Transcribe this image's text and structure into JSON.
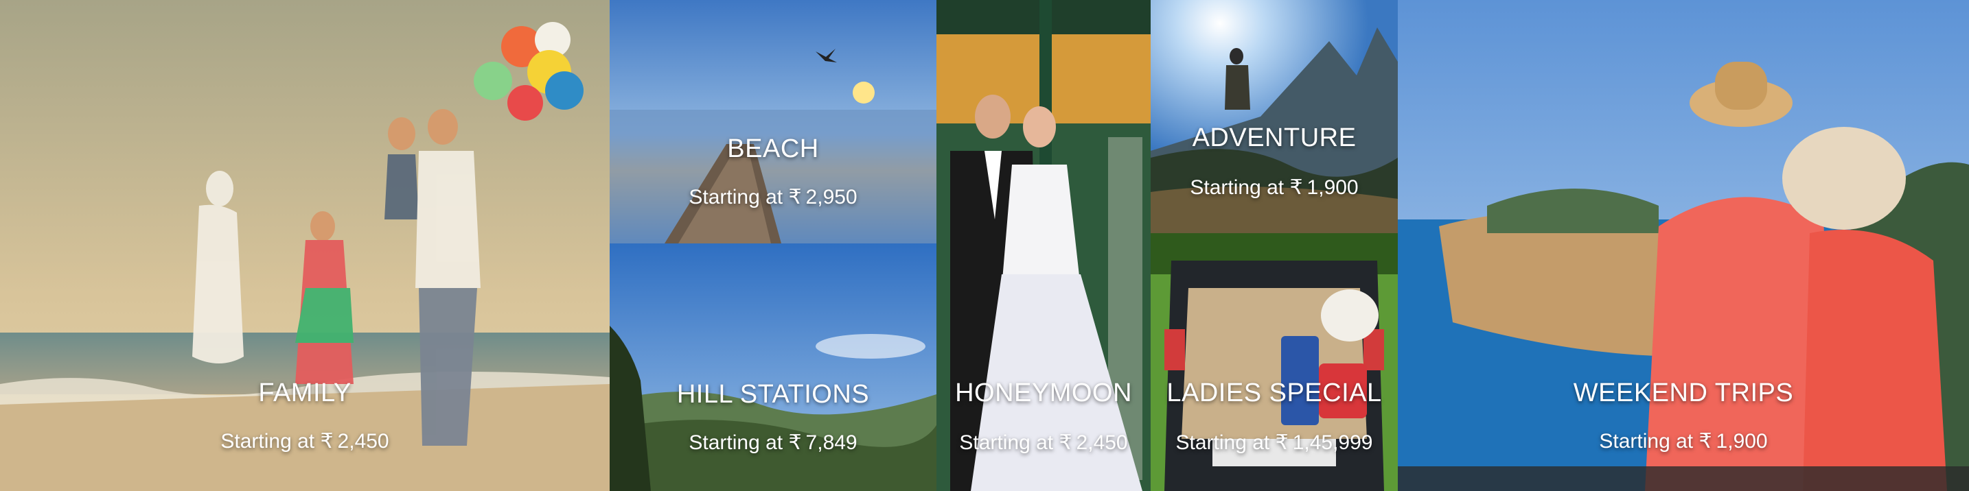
{
  "currency_symbol": "₹",
  "tiles": {
    "family": {
      "title": "FAMILY",
      "price_prefix": "Starting at",
      "price": "2,450"
    },
    "beach": {
      "title": "BEACH",
      "price_prefix": "Starting at",
      "price": "2,950"
    },
    "hill_stations": {
      "title": "HILL STATIONS",
      "price_prefix": "Starting at",
      "price": "7,849"
    },
    "honeymoon": {
      "title": "HONEYMOON",
      "price_prefix": "Starting at",
      "price": "2,450"
    },
    "adventure": {
      "title": "ADVENTURE",
      "price_prefix": "Starting at",
      "price": "1,900"
    },
    "ladies_special": {
      "title": "LADIES SPECIAL",
      "price_prefix": "Starting at",
      "price": "1,45,999"
    },
    "weekend_trips": {
      "title": "WEEKEND TRIPS",
      "price_prefix": "Starting at",
      "price": "1,900"
    }
  },
  "colors": {
    "sky_warm": "#cbb58a",
    "sea_blue": "#2f6fb4",
    "sunset_orange": "#f0a040",
    "mountain_green": "#3d5a2a",
    "caption_text": "#ffffff"
  }
}
